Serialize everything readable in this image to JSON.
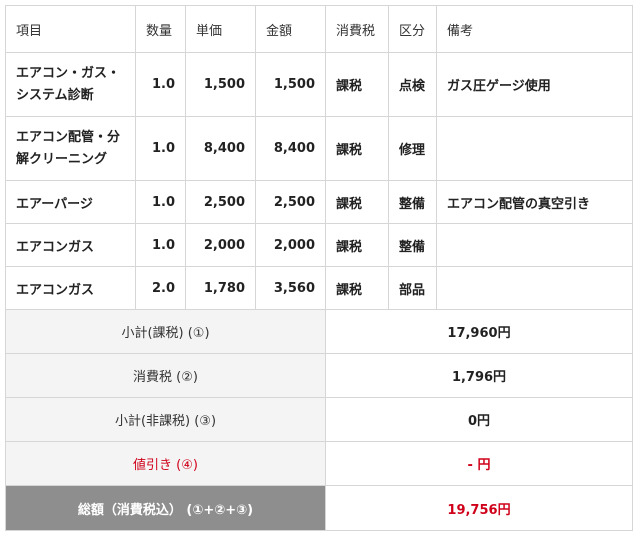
{
  "headers": {
    "item": "項目",
    "qty": "数量",
    "unit_price": "単価",
    "amount": "金額",
    "tax": "消費税",
    "category": "区分",
    "note": "備考"
  },
  "rows": [
    {
      "item_line1": "エアコン・ガス・",
      "item_line2": "システム診断",
      "qty": "1.0",
      "unit_price": "1,500",
      "amount": "1,500",
      "tax": "課税",
      "category": "点検",
      "note": "ガス圧ゲージ使用"
    },
    {
      "item_line1": "エアコン配管・分",
      "item_line2": "解クリーニング",
      "qty": "1.0",
      "unit_price": "8,400",
      "amount": "8,400",
      "tax": "課税",
      "category": "修理",
      "note": ""
    },
    {
      "item_line1": "エアーパージ",
      "item_line2": "",
      "qty": "1.0",
      "unit_price": "2,500",
      "amount": "2,500",
      "tax": "課税",
      "category": "整備",
      "note": "エアコン配管の真空引き"
    },
    {
      "item_line1": "エアコンガス",
      "item_line2": "",
      "qty": "1.0",
      "unit_price": "2,000",
      "amount": "2,000",
      "tax": "課税",
      "category": "整備",
      "note": ""
    },
    {
      "item_line1": "エアコンガス",
      "item_line2": "",
      "qty": "2.0",
      "unit_price": "1,780",
      "amount": "3,560",
      "tax": "課税",
      "category": "部品",
      "note": ""
    }
  ],
  "summary": {
    "subtotal_taxable_label": "小計(課税) (①)",
    "subtotal_taxable_value": "17,960円",
    "consumption_tax_label": "消費税 (②)",
    "consumption_tax_value": "1,796円",
    "subtotal_nontaxable_label": "小計(非課税) (③)",
    "subtotal_nontaxable_value": "0円",
    "discount_label": "値引き (④)",
    "discount_value": "- 円",
    "total_label": "総額（消費税込） (①+②+③)",
    "total_value": "19,756円"
  },
  "colors": {
    "accent_red": "#d0021b",
    "total_label_bg": "#8e8e8e",
    "summary_label_bg": "#f4f4f4"
  }
}
